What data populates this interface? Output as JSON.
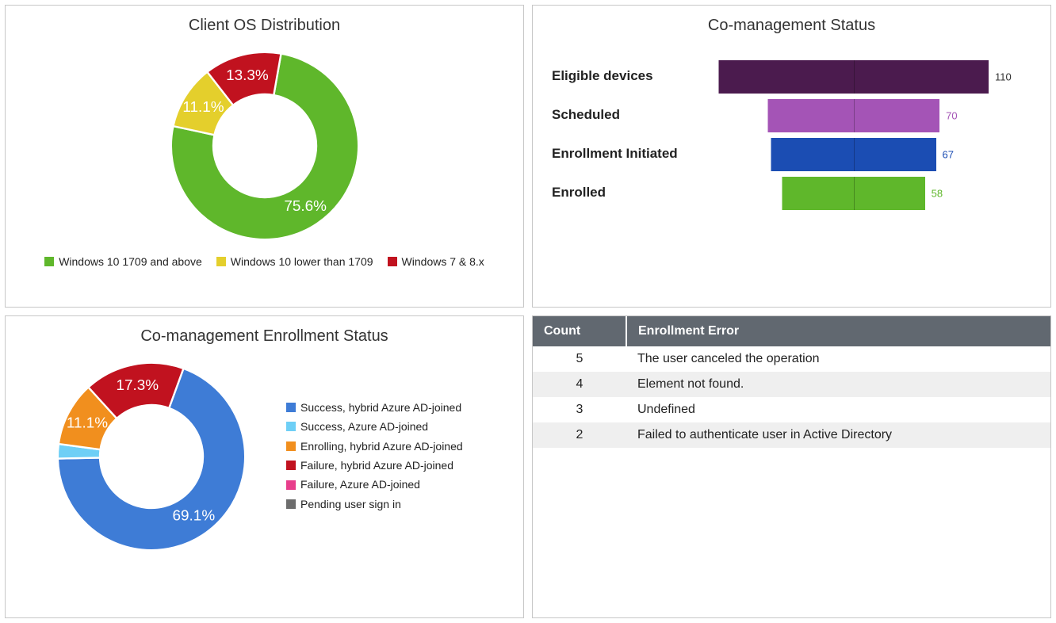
{
  "chart_data": [
    {
      "type": "pie",
      "title": "Client OS Distribution",
      "series": [
        {
          "name": "Windows 10 1709 and above",
          "value": 75.6,
          "color": "#5FB72B"
        },
        {
          "name": "Windows 10 lower than 1709",
          "value": 11.1,
          "color": "#E4CF2C"
        },
        {
          "name": "Windows 7 & 8.x",
          "value": 13.3,
          "color": "#C1121F"
        }
      ],
      "label_order": [
        2,
        1,
        0
      ]
    },
    {
      "type": "funnel",
      "title": "Co-management Status",
      "series": [
        {
          "name": "Eligible devices",
          "value": 110,
          "color": "#4B1B4E",
          "label_color": "#333"
        },
        {
          "name": "Scheduled",
          "value": 70,
          "color": "#A454B6",
          "label_color": "#A454B6"
        },
        {
          "name": "Enrollment Initiated",
          "value": 67,
          "color": "#1B4DB3",
          "label_color": "#1B4DB3"
        },
        {
          "name": "Enrolled",
          "value": 58,
          "color": "#5FB72B",
          "label_color": "#5FB72B"
        }
      ]
    },
    {
      "type": "pie",
      "title": "Co-management Enrollment Status",
      "series": [
        {
          "name": "Success, hybrid Azure AD-joined",
          "value": 69.1,
          "color": "#3E7CD6"
        },
        {
          "name": "Success, Azure AD-joined",
          "value": 2.5,
          "color": "#6ECFF6"
        },
        {
          "name": "Enrolling, hybrid Azure AD-joined",
          "value": 11.1,
          "color": "#F18F1E"
        },
        {
          "name": "Failure, hybrid Azure AD-joined",
          "value": 17.3,
          "color": "#C1121F"
        },
        {
          "name": "Failure, Azure AD-joined",
          "value": 0.0,
          "color": "#E83E8C"
        },
        {
          "name": "Pending user sign in",
          "value": 0.0,
          "color": "#6D6D6D"
        }
      ],
      "visible_labels": {
        "0": "69.1%",
        "2": "11.1%",
        "3": "17.3%"
      }
    },
    {
      "type": "table",
      "columns": [
        "Count",
        "Enrollment Error"
      ],
      "rows": [
        [
          5,
          "The user canceled the operation"
        ],
        [
          4,
          "Element not found."
        ],
        [
          3,
          "Undefined"
        ],
        [
          2,
          "Failed to authenticate user in Active Directory"
        ]
      ]
    }
  ],
  "tiles": {
    "os": {
      "title": "Client OS Distribution"
    },
    "funnel": {
      "title": "Co-management Status"
    },
    "enroll": {
      "title": "Co-management Enrollment Status"
    }
  },
  "table": {
    "headers": {
      "count": "Count",
      "error": "Enrollment Error"
    }
  }
}
